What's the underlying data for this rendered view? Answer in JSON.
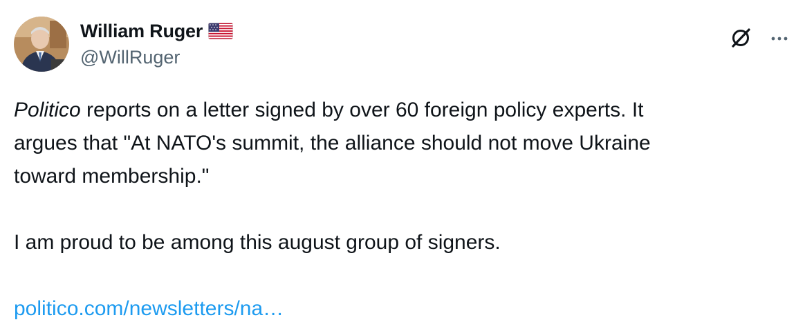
{
  "author": {
    "display_name": "William Ruger",
    "handle": "@WillRuger",
    "flag": "us-flag-icon"
  },
  "actions": {
    "grok_icon": "grok-icon",
    "more_icon": "more-icon"
  },
  "tweet": {
    "para1_italic": "Politico",
    "para1_line1_rest": " reports on a letter signed by over 60 foreign policy experts. It",
    "para1_line2": "argues that \"At NATO's summit, the alliance should not move Ukraine",
    "para1_line3": "toward membership.\"",
    "para2": "I am proud to be among this august group of signers.",
    "link": "politico.com/newsletters/na…"
  },
  "colors": {
    "text": "#0f1419",
    "secondary": "#536471",
    "link": "#1d9bf0"
  }
}
